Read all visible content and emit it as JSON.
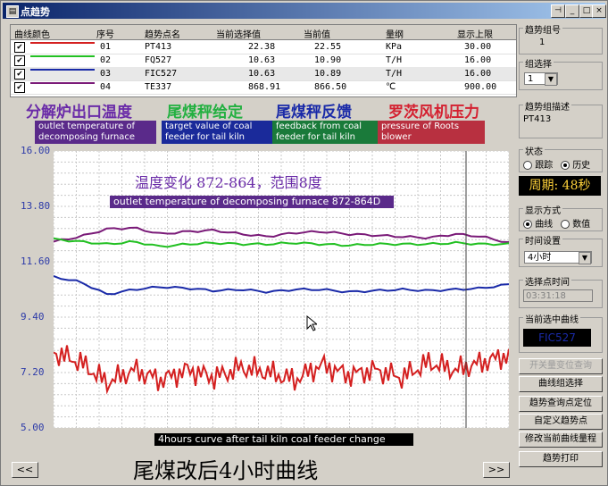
{
  "window": {
    "title": "点趋势",
    "controls": [
      "⊣",
      "_",
      "□",
      "×"
    ]
  },
  "table": {
    "headers": [
      "曲线颜色",
      "序号",
      "趋势点名",
      "当前选择值",
      "当前值",
      "量纲",
      "显示上限"
    ],
    "rows": [
      {
        "color": "#d42020",
        "index": "01",
        "name": "PT413",
        "selected_value": "22.38",
        "current_value": "22.55",
        "unit": "KPa",
        "upper": "30.00"
      },
      {
        "color": "#22c022",
        "index": "02",
        "name": "FQ527",
        "selected_value": "10.63",
        "current_value": "10.90",
        "unit": "T/H",
        "upper": "16.00"
      },
      {
        "color": "#1a2aa8",
        "index": "03",
        "name": "FIC527",
        "selected_value": "10.63",
        "current_value": "10.89",
        "unit": "T/H",
        "upper": "16.00"
      },
      {
        "color": "#7a1a78",
        "index": "04",
        "name": "TE337",
        "selected_value": "868.91",
        "current_value": "866.50",
        "unit": "℃",
        "upper": "900.00"
      }
    ]
  },
  "banners": {
    "b1": {
      "zh": "分解炉出口温度",
      "en": "outlet temperature of decomposing furnace",
      "color": "#6a2ba8",
      "tag_bg": "#5a2a8a"
    },
    "b2": {
      "zh": "尾煤秤给定",
      "en": "target value of coal feeder for tail kiln",
      "color": "#22b040",
      "tag_bg": "#1a2a9a"
    },
    "b3": {
      "zh": "尾煤秤反馈",
      "en": "feedback from coal feeder for tail kiln",
      "color": "#1a2aa8",
      "tag_bg": "#1a7a3a"
    },
    "b4": {
      "zh": "罗茨风机压力",
      "en": "pressure of Roots blower",
      "color": "#d42030",
      "tag_bg": "#b83040"
    }
  },
  "chart_data": {
    "type": "line",
    "y_ticks": [
      "16.00",
      "13.80",
      "11.60",
      "9.40",
      "7.20",
      "5.00"
    ],
    "ylim": [
      5.0,
      16.0
    ],
    "grid": true,
    "series": [
      {
        "name": "TE337",
        "color": "#7a1a78",
        "values": [
          12.4,
          12.6,
          12.9,
          12.95,
          12.7,
          12.8,
          12.85,
          12.7,
          12.6,
          12.75,
          12.8,
          12.7,
          12.65,
          12.6,
          12.55,
          12.7,
          12.6,
          12.35
        ]
      },
      {
        "name": "FQ527",
        "color": "#22c022",
        "values": [
          12.5,
          12.4,
          12.3,
          12.4,
          12.2,
          12.3,
          12.35,
          12.3,
          12.3,
          12.35,
          12.3,
          12.25,
          12.3,
          12.3,
          12.3,
          12.35,
          12.3,
          12.3
        ]
      },
      {
        "name": "FIC527",
        "color": "#1a2aa8",
        "values": [
          11.0,
          10.8,
          10.3,
          10.5,
          10.6,
          10.55,
          10.45,
          10.5,
          10.4,
          10.5,
          10.5,
          10.4,
          10.45,
          10.5,
          10.45,
          10.5,
          10.55,
          10.7
        ]
      },
      {
        "name": "PT413",
        "color": "#d42020",
        "values": [
          8.0,
          7.6,
          6.8,
          7.3,
          6.9,
          7.3,
          7.0,
          7.4,
          7.2,
          6.9,
          7.5,
          7.1,
          7.3,
          7.0,
          7.6,
          7.3,
          7.6,
          7.9
        ]
      }
    ],
    "title": "温度变化 872-864，范围8度",
    "annotation": "outlet temperature of decomposing furnace 872-864D",
    "footer_note": "4hours curve after tail kiln coal feeder change"
  },
  "side": {
    "group_no_label": "趋势组号",
    "group_no": "1",
    "group_select_label": "组选择",
    "group_select_value": "1",
    "group_desc_label": "趋势组描述",
    "group_desc": "PT413",
    "state_label": "状态",
    "state_opt1": "跟踪",
    "state_opt2": "历史",
    "period_label": "周期: 48秒",
    "display_label": "显示方式",
    "display_opt1": "曲线",
    "display_opt2": "数值",
    "time_label": "时间设置",
    "time_value": "4小时",
    "point_time_label": "选择点时间",
    "point_time": "03:31:18",
    "current_curve_label": "当前选中曲线",
    "current_curve": "FIC527",
    "buttons": {
      "b1": "开关量变位查询",
      "b2": "曲线组选择",
      "b3": "趋势查询点定位",
      "b4": "自定义趋势点",
      "b5": "修改当前曲线量程",
      "b6": "趋势打印"
    }
  },
  "bottom_caption": "尾煤改后4小时曲线",
  "nav": {
    "prev": "<<",
    "next": ">>"
  }
}
